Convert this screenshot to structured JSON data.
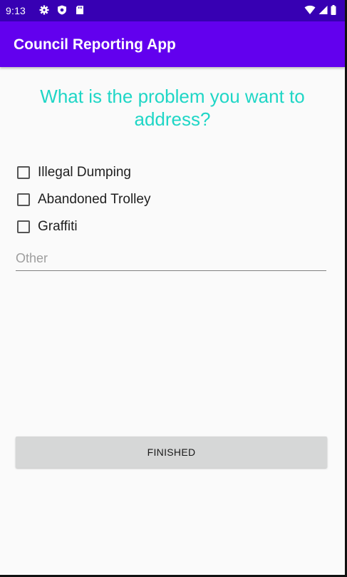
{
  "status_bar": {
    "time": "9:13",
    "left_icons": [
      "gear-icon",
      "shield-icon",
      "sd-card-icon"
    ],
    "right_icons": [
      "wifi-icon",
      "signal-icon",
      "battery-icon"
    ]
  },
  "app_bar": {
    "title": "Council Reporting App",
    "color": "#6200ee",
    "status_color": "#3700b3"
  },
  "form": {
    "question": "What is the problem you want to address?",
    "question_color": "#1fd6c6",
    "options": [
      {
        "label": "Illegal Dumping",
        "checked": false
      },
      {
        "label": "Abandoned Trolley",
        "checked": false
      },
      {
        "label": "Graffiti",
        "checked": false
      }
    ],
    "other": {
      "placeholder": "Other",
      "value": ""
    },
    "finish_label": "FINISHED"
  }
}
